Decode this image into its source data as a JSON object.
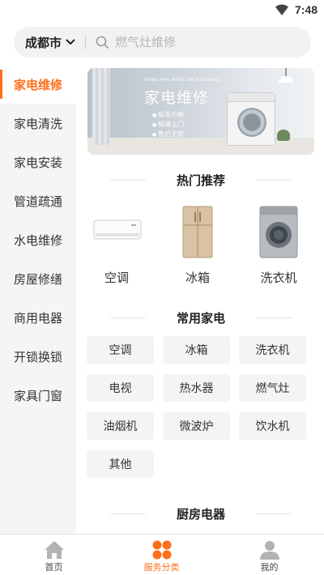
{
  "status_bar": {
    "time": "7:48",
    "icons": [
      "wifi-icon"
    ]
  },
  "header": {
    "city": "成都市",
    "search_placeholder": "燃气灶维修",
    "icons": [
      "chevron-down-icon",
      "search-icon"
    ]
  },
  "sidebar": {
    "active_index": 0,
    "items": [
      {
        "label": "家电维修"
      },
      {
        "label": "家电清洗"
      },
      {
        "label": "家电安装"
      },
      {
        "label": "管道疏通"
      },
      {
        "label": "水电维修"
      },
      {
        "label": "房屋修缮"
      },
      {
        "label": "商用电器"
      },
      {
        "label": "开锁换锁"
      },
      {
        "label": "家具门窗"
      }
    ]
  },
  "banner": {
    "title": "家电维修",
    "subtitle": "HOME APPLIANCE MAINTENANCE",
    "bullets": [
      "标准价格",
      "极速上门",
      "售后无忧"
    ]
  },
  "sections": {
    "hot": {
      "title": "热门推荐"
    },
    "common": {
      "title": "常用家电"
    },
    "kitchen": {
      "title": "厨房电器"
    }
  },
  "hot_items": [
    {
      "label": "空调",
      "icon": "air-conditioner-icon"
    },
    {
      "label": "冰箱",
      "icon": "refrigerator-icon"
    },
    {
      "label": "洗衣机",
      "icon": "washing-machine-icon"
    }
  ],
  "common_items": [
    "空调",
    "冰箱",
    "洗衣机",
    "电视",
    "热水器",
    "燃气灶",
    "油烟机",
    "微波炉",
    "饮水机",
    "其他"
  ],
  "tabbar": {
    "active_index": 1,
    "items": [
      {
        "label": "首页",
        "icon": "home-icon"
      },
      {
        "label": "服务分类",
        "icon": "category-icon"
      },
      {
        "label": "我的",
        "icon": "user-icon"
      }
    ]
  },
  "colors": {
    "accent": "#ff6f1c",
    "sidebar_bg": "#f5f5f5",
    "chip_bg": "#f4f4f4"
  }
}
